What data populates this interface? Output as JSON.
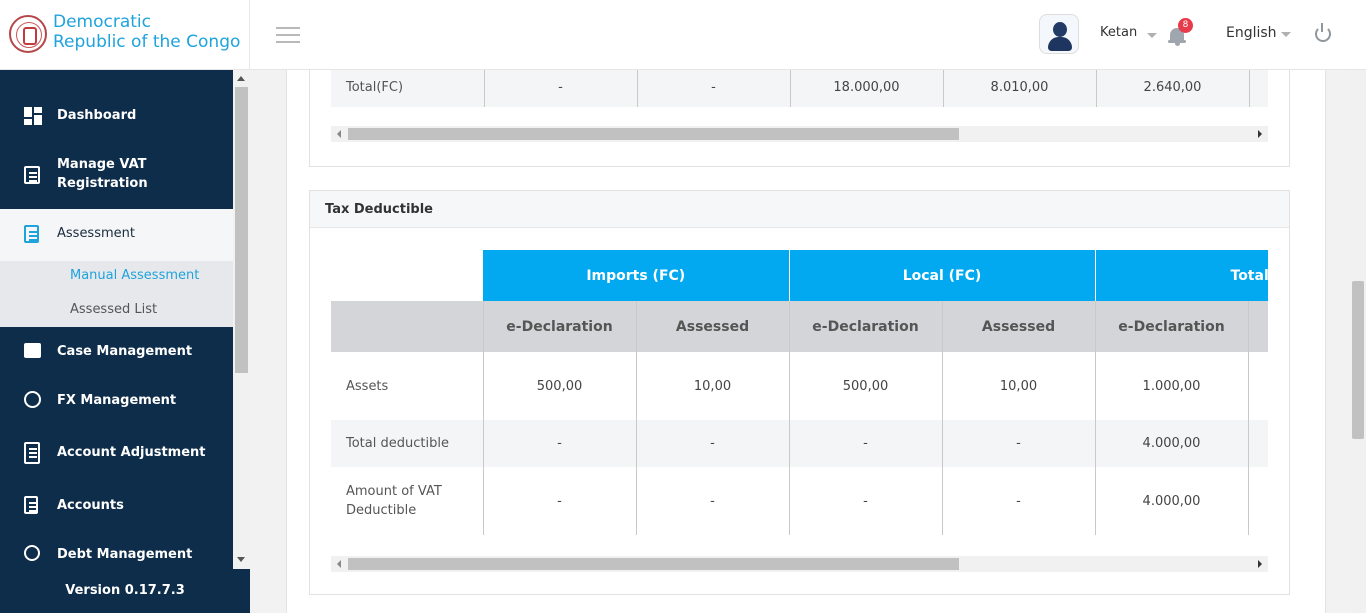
{
  "brand": {
    "line1": "Democratic",
    "line2": "Republic of the Congo"
  },
  "header": {
    "user_name": "Ketan",
    "notification_count": "8",
    "language": "English"
  },
  "sidebar": {
    "items": [
      {
        "label": "Dashboard",
        "icon": "dashboard-icon"
      },
      {
        "label_line1": "Manage VAT",
        "label_line2": "Registration",
        "icon": "document-icon"
      },
      {
        "label": "Assessment",
        "icon": "assessment-icon",
        "active": true
      },
      {
        "label": "Case Management",
        "icon": "folder-icon"
      },
      {
        "label": "FX Management",
        "icon": "fx-icon"
      },
      {
        "label": "Account Adjustment",
        "icon": "calculator-icon"
      },
      {
        "label": "Accounts",
        "icon": "receipt-icon"
      },
      {
        "label": "Debt Management",
        "icon": "debt-icon"
      }
    ],
    "sub_items": [
      {
        "label": "Manual Assessment",
        "active": true
      },
      {
        "label": "Assessed List"
      }
    ],
    "version": "Version 0.17.7.3"
  },
  "top_table": {
    "row_label": "Total(FC)",
    "cells": [
      "-",
      "-",
      "18.000,00",
      "8.010,00",
      "2.640,00"
    ]
  },
  "tax_deductible": {
    "title": "Tax Deductible",
    "group_headers": [
      "Imports (FC)",
      "Local (FC)",
      "Total (FC)"
    ],
    "sub_headers": [
      "e-Declaration",
      "Assessed",
      "e-Declaration",
      "Assessed",
      "e-Declaration"
    ],
    "rows": [
      {
        "label": "Assets",
        "cells": [
          "500,00",
          "10,00",
          "500,00",
          "10,00",
          "1.000,00"
        ]
      },
      {
        "label": "Total deductible",
        "cells": [
          "-",
          "-",
          "-",
          "-",
          "4.000,00"
        ]
      },
      {
        "label_line1": "Amount of VAT",
        "label_line2": "Deductible",
        "cells": [
          "-",
          "-",
          "-",
          "-",
          "4.000,00"
        ]
      }
    ]
  },
  "colors": {
    "sidebar_bg": "#0e2d4a",
    "accent": "#03a9f0",
    "brand_text": "#1ea3dc",
    "badge": "#e73b4c"
  }
}
